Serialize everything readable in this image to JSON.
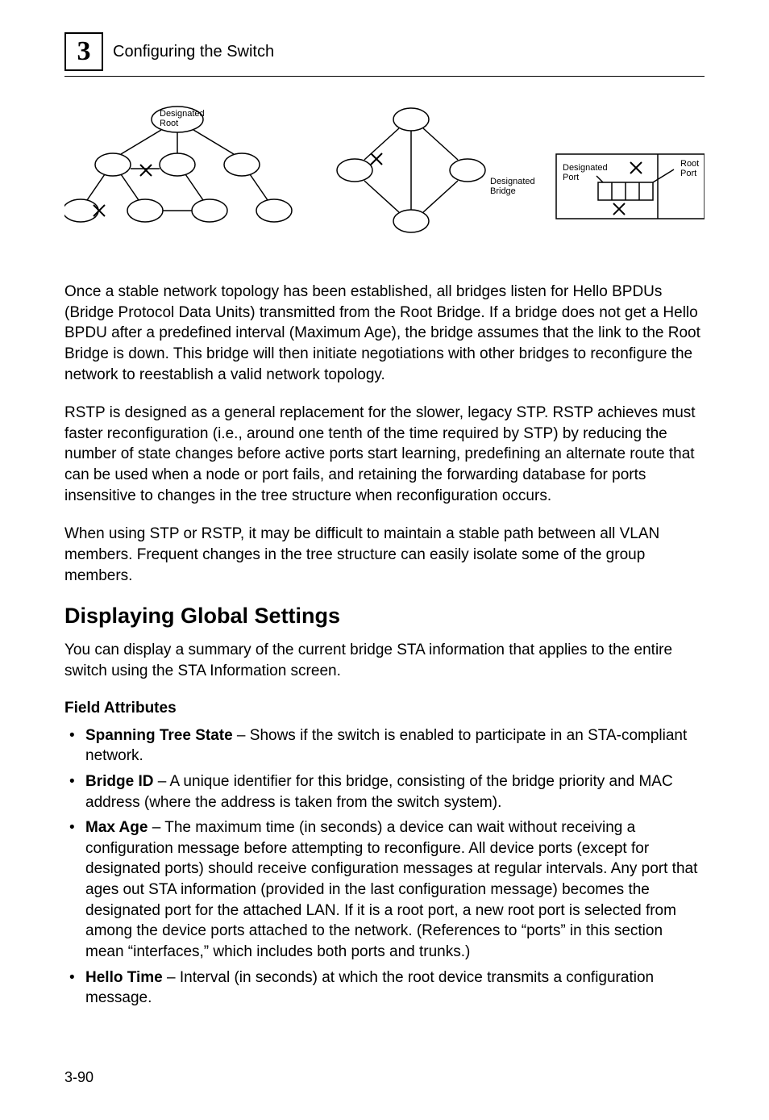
{
  "header": {
    "chapter_number": "3",
    "title": "Configuring the Switch"
  },
  "figure": {
    "labels": {
      "designated_root": "Designated\nRoot",
      "designated_bridge": "Designated\nBridge",
      "designated_port": "Designated\nPort",
      "root_port": "Root\nPort"
    }
  },
  "paragraphs": {
    "p1": "Once a stable network topology has been established, all bridges listen for Hello BPDUs (Bridge Protocol Data Units) transmitted from the Root Bridge. If a bridge does not get a Hello BPDU after a predefined interval (Maximum Age), the bridge assumes that the link to the Root Bridge is down. This bridge will then initiate negotiations with other bridges to reconfigure the network to reestablish a valid network topology.",
    "p2": "RSTP is designed as a general replacement for the slower, legacy STP. RSTP achieves must faster reconfiguration (i.e., around one tenth of the time required by STP) by reducing the number of state changes before active ports start learning, predefining an alternate route that can be used when a node or port fails, and retaining the forwarding database for ports insensitive to changes in the tree structure when reconfiguration occurs.",
    "p3": "When using STP or RSTP, it may be difficult to maintain a stable path between all VLAN members. Frequent changes in the tree structure can easily isolate some of the group members."
  },
  "section": {
    "heading": "Displaying Global Settings",
    "intro": "You can display a summary of the current bridge STA information that applies to the entire switch using the STA Information screen.",
    "field_attributes_label": "Field Attributes",
    "bullets": [
      {
        "term": "Spanning Tree State",
        "desc": " – Shows if the switch is enabled to participate in an STA-compliant network."
      },
      {
        "term": "Bridge ID",
        "desc": " – A unique identifier for this bridge, consisting of the bridge priority and MAC address (where the address is taken from the switch system)."
      },
      {
        "term": "Max Age",
        "desc": " – The maximum time (in seconds) a device can wait without receiving a configuration message before attempting to reconfigure. All device ports (except for designated ports) should receive configuration messages at regular intervals. Any port that ages out STA information (provided in the last configuration message) becomes the designated port for the attached LAN. If it is a root port, a new root port is selected from among the device ports attached to the network. (References to “ports” in this section mean “interfaces,” which includes both ports and trunks.)"
      },
      {
        "term": "Hello Time",
        "desc": " – Interval (in seconds) at which the root device transmits a configuration message."
      }
    ]
  },
  "footer": {
    "page_number": "3-90"
  }
}
